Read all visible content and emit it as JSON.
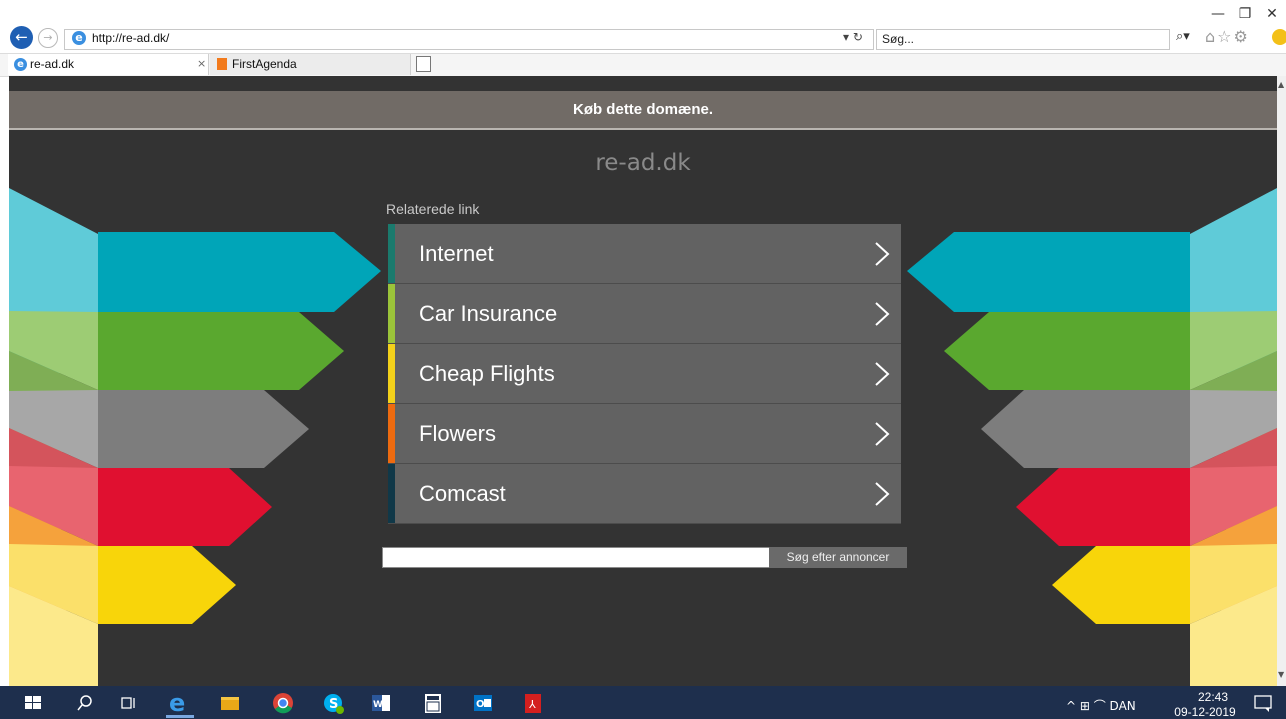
{
  "window": {
    "minimize_glyph": "—",
    "restore_glyph": "❐",
    "close_glyph": "✕"
  },
  "nav": {
    "back_glyph": "←",
    "forward_glyph": "→"
  },
  "address": {
    "url": "http://re-ad.dk/",
    "dropdown_glyph": "▾",
    "refresh_glyph": "↻"
  },
  "search": {
    "placeholder": "Søg...",
    "icon_glyph": "⌕▾"
  },
  "tools": {
    "glyphs": "⌂☆⚙"
  },
  "tabs": [
    {
      "label": "re-ad.dk",
      "close": "×"
    },
    {
      "label": "FirstAgenda"
    }
  ],
  "page": {
    "buy_text": "Køb dette domæne.",
    "domain": "re-ad.dk",
    "related_label": "Relaterede link",
    "links": [
      {
        "label": "Internet",
        "color": "#1a7a6d"
      },
      {
        "label": "Car Insurance",
        "color": "#9bc43a"
      },
      {
        "label": "Cheap Flights",
        "color": "#f3d11a"
      },
      {
        "label": "Flowers",
        "color": "#ee6b10"
      },
      {
        "label": "Comcast",
        "color": "#103848"
      }
    ],
    "ad_button": "Søg efter annoncer"
  },
  "colors": {
    "cyan": "#00a5b8",
    "green": "#5aa82f",
    "grey": "#7d7d7d",
    "red": "#e01030",
    "yellow": "#f8d50a"
  },
  "taskbar": {
    "tray_text": "^ ⊞ ⌒ DAN",
    "time": "22:43",
    "date": "09-12-2019"
  }
}
